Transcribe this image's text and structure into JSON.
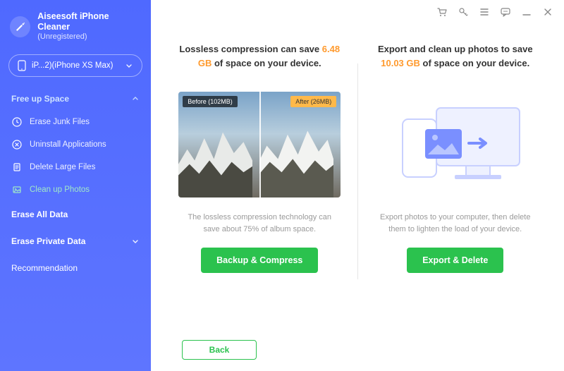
{
  "app": {
    "title": "Aiseesoft iPhone Cleaner",
    "subtitle": "(Unregistered)"
  },
  "device": {
    "label": "iP...2)(iPhone XS Max)"
  },
  "sidebar": {
    "freeup_label": "Free up Space",
    "items": [
      {
        "label": "Erase Junk Files"
      },
      {
        "label": "Uninstall Applications"
      },
      {
        "label": "Delete Large Files"
      },
      {
        "label": "Clean up Photos"
      }
    ],
    "erase_all": "Erase All Data",
    "erase_private": "Erase Private Data",
    "recommendation": "Recommendation"
  },
  "compress": {
    "headline_pre": "Lossless compression can save ",
    "headline_amount": "6.48 GB",
    "headline_post": " of space on your device.",
    "before_badge": "Before (102MB)",
    "after_badge": "After (26MB)",
    "caption": "The lossless compression technology can save about 75% of album space.",
    "button": "Backup & Compress"
  },
  "export": {
    "headline_pre": "Export and clean up photos to save ",
    "headline_amount": "10.03 GB",
    "headline_post": " of space on your device.",
    "caption": "Export photos to your computer, then delete them to lighten the load of your device.",
    "button": "Export & Delete"
  },
  "footer": {
    "back": "Back"
  }
}
